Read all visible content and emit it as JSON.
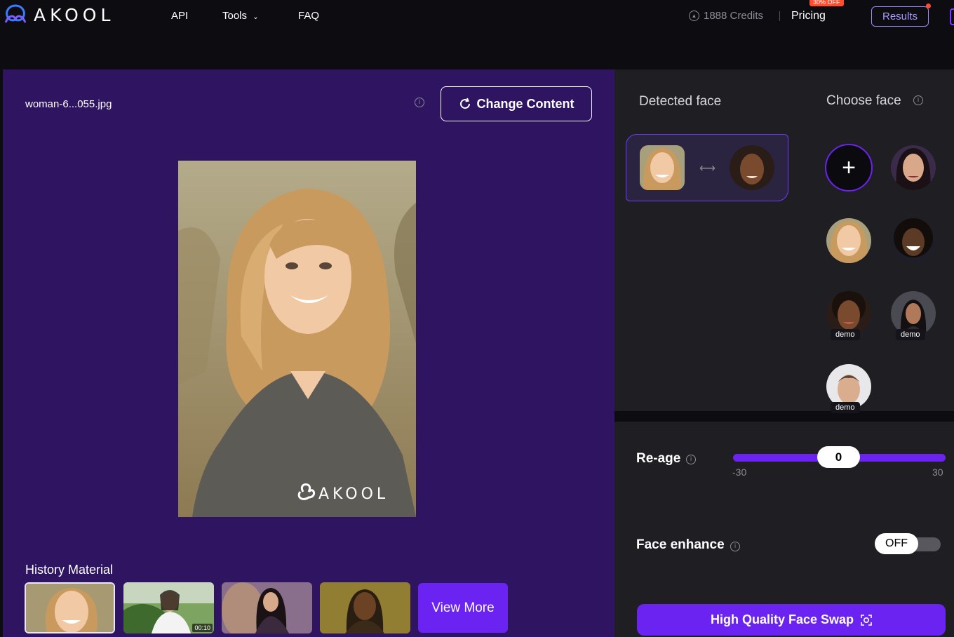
{
  "nav": {
    "brand": "AKOOL",
    "links": [
      "API",
      "Tools",
      "FAQ"
    ],
    "credits": "1888 Credits",
    "pricing": "Pricing",
    "pricing_badge": "30% OFF",
    "results": "Results"
  },
  "editor": {
    "file_name": "woman-6...055.jpg",
    "change_content": "Change Content",
    "watermark": "AKOOL",
    "history_title": "History Material",
    "history_video_duration": "00:10",
    "view_more": "View More"
  },
  "faces": {
    "detected_title": "Detected face",
    "choose_title": "Choose face",
    "demo_label": "demo"
  },
  "settings": {
    "reage_label": "Re-age",
    "reage_value": "0",
    "reage_min": "-30",
    "reage_max": "30",
    "enhance_label": "Face enhance",
    "enhance_state": "OFF",
    "submit": "High Quality Face Swap"
  },
  "colors": {
    "accent": "#6a23f0",
    "left_panel": "#2e1461",
    "right_panel": "#1f1e23",
    "badge": "#ff4d2e"
  }
}
